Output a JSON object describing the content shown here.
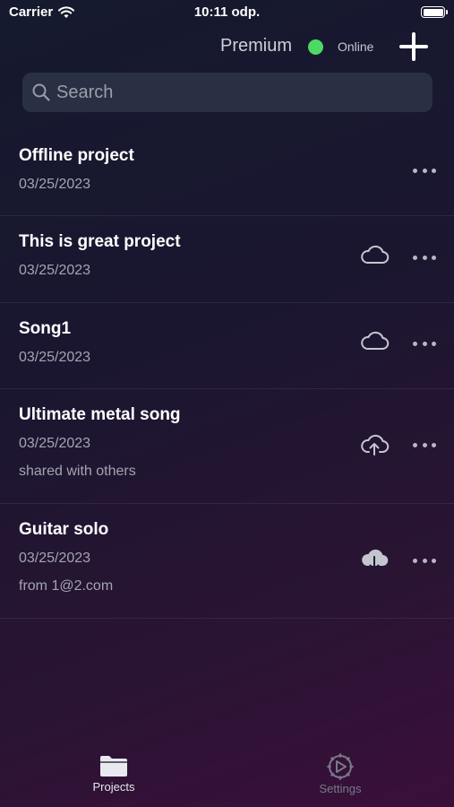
{
  "status_bar": {
    "carrier": "Carrier",
    "time": "10:11 odp."
  },
  "header": {
    "premium_label": "Premium",
    "online_label": "Online"
  },
  "search": {
    "placeholder": "Search"
  },
  "projects": [
    {
      "title": "Offline project",
      "date": "03/25/2023",
      "extra": "",
      "cloud": "none"
    },
    {
      "title": "This is great project",
      "date": "03/25/2023",
      "extra": "",
      "cloud": "cloud-icon"
    },
    {
      "title": "Song1",
      "date": "03/25/2023",
      "extra": "",
      "cloud": "cloud-icon"
    },
    {
      "title": "Ultimate metal song",
      "date": "03/25/2023",
      "extra": "shared with others",
      "cloud": "cloud-upload-icon"
    },
    {
      "title": "Guitar solo",
      "date": "03/25/2023",
      "extra": "from 1@2.com",
      "cloud": "cloud-download-icon"
    }
  ],
  "tabs": [
    {
      "label": "Projects",
      "icon": "folder-icon",
      "active": true
    },
    {
      "label": "Settings",
      "icon": "settings-icon",
      "active": false
    }
  ],
  "colors": {
    "online": "#4cd964",
    "text_secondary": "#a3a5b0"
  }
}
